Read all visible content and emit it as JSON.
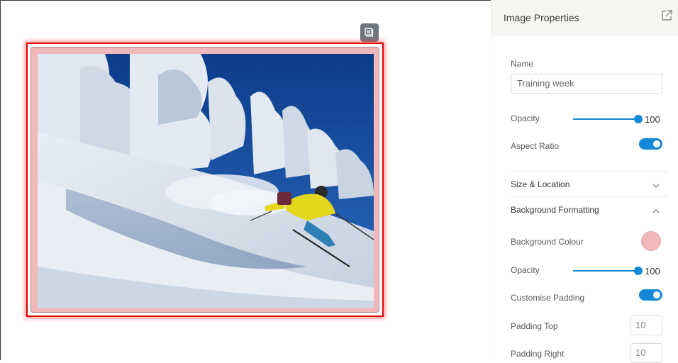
{
  "panel": {
    "title": "Image Properties",
    "name_label": "Name",
    "name_value": "Training week",
    "opacity_label": "Opacity",
    "opacity_value": "100",
    "aspect_ratio_label": "Aspect Ratio",
    "aspect_ratio_on": true,
    "sections": {
      "size_location": "Size & Location",
      "background_formatting": "Background Formatting"
    },
    "background": {
      "colour_label": "Background Colour",
      "colour": "#f0b8b8",
      "opacity_label": "Opacity",
      "opacity_value": "100",
      "custom_padding_label": "Customise Padding",
      "custom_padding_on": true,
      "padding_top_label": "Padding Top",
      "padding_top_value": "10",
      "padding_right_label": "Padding Right",
      "padding_right_value": "10"
    }
  },
  "colors": {
    "accent": "#1588d7",
    "selection": "#e40000",
    "frame_background": "#f0b8b8"
  },
  "icons": {
    "widget_toolbar": "image-settings-icon",
    "expand": "external-link-icon",
    "collapse": "chevron-down-icon",
    "expand_section": "chevron-up-icon"
  }
}
